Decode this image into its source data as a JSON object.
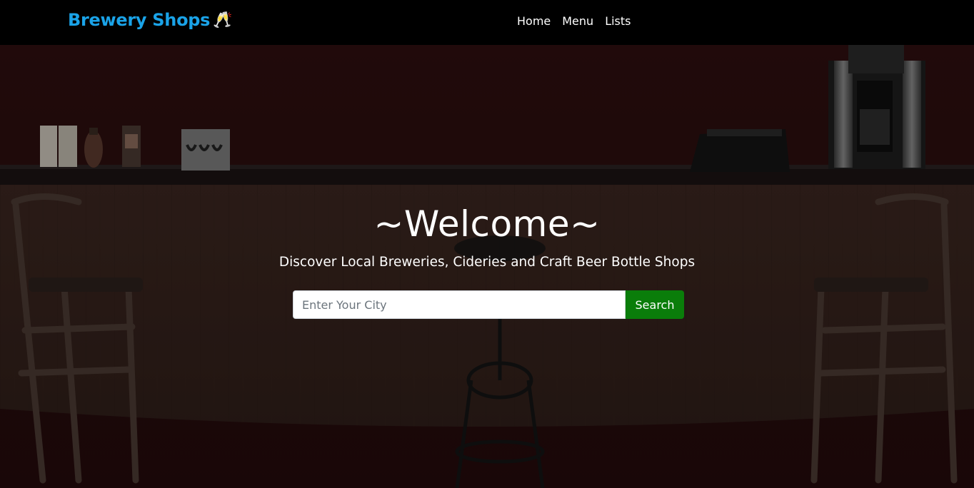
{
  "navbar": {
    "brand": "Brewery Shops",
    "brand_icon": "🥂",
    "links": [
      {
        "label": "Home"
      },
      {
        "label": "Menu"
      },
      {
        "label": "Lists"
      }
    ]
  },
  "hero": {
    "title": "~Welcome~",
    "subtitle": "Discover Local Breweries, Cideries and Craft Beer Bottle Shops",
    "search": {
      "placeholder": "Enter Your City",
      "value": "",
      "button_label": "Search"
    }
  },
  "colors": {
    "brand": "#1aa3e8",
    "navbar_bg": "#000000",
    "search_button": "#0a7d0a",
    "hero_bg": "#2b0d0e"
  }
}
